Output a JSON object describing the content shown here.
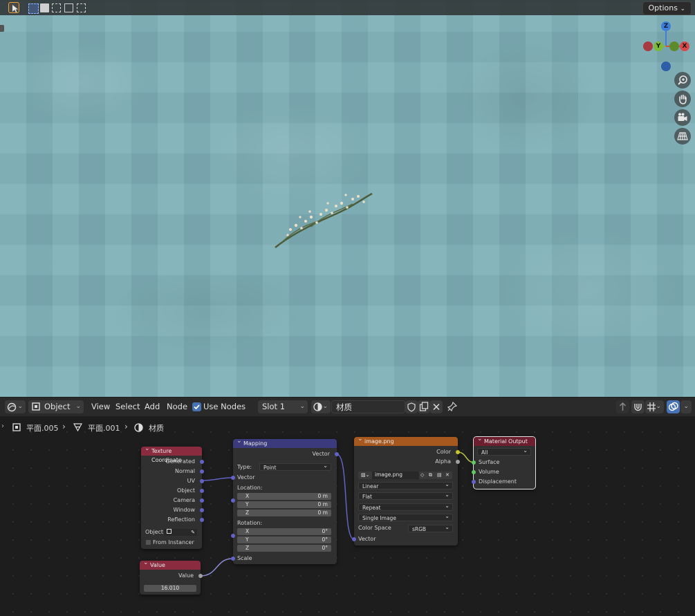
{
  "viewport": {
    "options_label": "Options",
    "gizmo": {
      "z": "Z",
      "y": "Y",
      "x": "X"
    }
  },
  "node_header": {
    "object_mode": "Object",
    "menus": {
      "view": "View",
      "select": "Select",
      "add": "Add",
      "node": "Node"
    },
    "use_nodes_label": "Use Nodes",
    "use_nodes_checked": true,
    "slot": "Slot 1",
    "material_name": "材质"
  },
  "breadcrumb": {
    "object": "平面.005",
    "mesh": "平面.001",
    "material": "材质"
  },
  "nodes": {
    "texture_coordinate": {
      "title": "Texture Coordinate",
      "outputs": [
        "Generated",
        "Normal",
        "UV",
        "Object",
        "Camera",
        "Window",
        "Reflection"
      ],
      "object_label": "Object:",
      "from_instancer": "From Instancer"
    },
    "value": {
      "title": "Value",
      "output": "Value",
      "value": "16.010"
    },
    "mapping": {
      "title": "Mapping",
      "output": "Vector",
      "type_label": "Type:",
      "type_value": "Point",
      "vector_input": "Vector",
      "location_label": "Location:",
      "location": [
        {
          "axis": "X",
          "value": "0 m"
        },
        {
          "axis": "Y",
          "value": "0 m"
        },
        {
          "axis": "Z",
          "value": "0 m"
        }
      ],
      "rotation_label": "Rotation:",
      "rotation": [
        {
          "axis": "X",
          "value": "0°"
        },
        {
          "axis": "Y",
          "value": "0°"
        },
        {
          "axis": "Z",
          "value": "0°"
        }
      ],
      "scale_input": "Scale"
    },
    "image": {
      "title": "image.png",
      "outputs": [
        "Color",
        "Alpha"
      ],
      "image_name": "image.png",
      "interpolation": "Linear",
      "projection": "Flat",
      "extension": "Repeat",
      "source": "Single Image",
      "color_space_label": "Color Space",
      "color_space": "sRGB",
      "vector_input": "Vector"
    },
    "material_output": {
      "title": "Material Output",
      "target": "All",
      "inputs": [
        "Surface",
        "Volume",
        "Displacement"
      ]
    }
  },
  "colors": {
    "tex_coord_header": "#8a2b3f",
    "mapping_header": "#3b3a7c",
    "image_header": "#a6581f",
    "output_header": "#6e1f2f",
    "vector_socket": "#6363c7",
    "color_socket": "#c7c729",
    "float_socket": "#a1a1a1",
    "shader_socket": "#63c763"
  }
}
